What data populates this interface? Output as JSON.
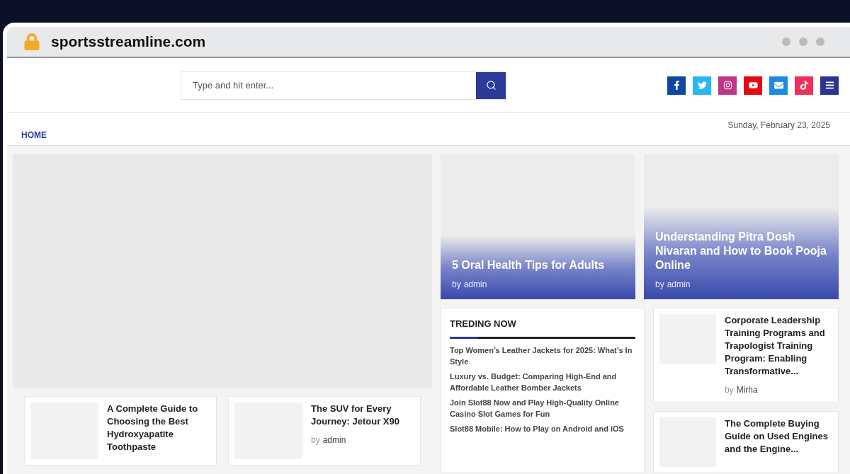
{
  "browser": {
    "address": "sportsstreamline.com",
    "secure": true
  },
  "search": {
    "placeholder": "Type and hit enter..."
  },
  "social": [
    {
      "kind": "facebook",
      "color": "#0d47a1"
    },
    {
      "kind": "twitter",
      "color": "#29b6f6"
    },
    {
      "kind": "instagram",
      "color": "#c13584"
    },
    {
      "kind": "youtube",
      "color": "#e50914"
    },
    {
      "kind": "email",
      "color": "#1e88e5"
    },
    {
      "kind": "tiktok",
      "color": "#f0305a"
    },
    {
      "kind": "menu",
      "color": "#283593"
    }
  ],
  "nav": {
    "items": [
      {
        "label": "HOME",
        "selected": true
      }
    ],
    "date": "Sunday, February 23, 2025"
  },
  "hero_posts": [
    {
      "title": "5 Oral Health Tips for Adults",
      "by": "by",
      "author": "admin"
    },
    {
      "title": "Understanding Pitra Dosh Nivaran and How to Book Pooja Online",
      "by": "by",
      "author": "admin"
    }
  ],
  "left_posts": [
    {
      "title": "A Complete Guide to Choosing the Best Hydroxyapatite Toothpaste"
    },
    {
      "title": "The SUV for Every Journey: Jetour X90",
      "by": "by",
      "author": "admin"
    }
  ],
  "trending": {
    "title": "TREDING NOW",
    "items": [
      "Top Women’s Leather Jackets for 2025: What’s In Style",
      "Luxury vs. Budget: Comparing High-End and Affordable Leather Bomber Jackets",
      "Join Slot88 Now and Play High-Quality Online Casino Slot Games for Fun",
      "Slot88 Mobile: How to Play on Android and iOS"
    ]
  },
  "right_posts": [
    {
      "title": "Corporate Leadership Training Programs and Trapologist Training Program: Enabling Transformative...",
      "by": "by",
      "author": "Mirha"
    },
    {
      "title": "The Complete Buying Guide on Used Engines and the Engine..."
    }
  ]
}
